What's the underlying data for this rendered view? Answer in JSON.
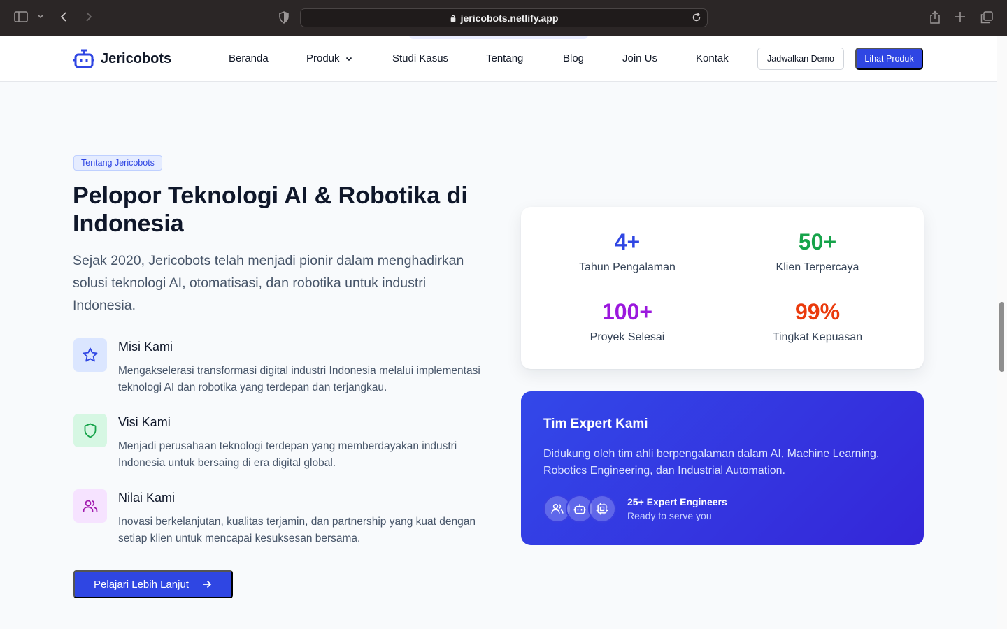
{
  "browser": {
    "url": "jericobots.netlify.app"
  },
  "nav": {
    "brand": "Jericobots",
    "items": [
      "Beranda",
      "Produk",
      "Studi Kasus",
      "Tentang",
      "Blog",
      "Join Us",
      "Kontak"
    ],
    "demo_button": "Jadwalkan Demo",
    "products_button": "Lihat Produk"
  },
  "about": {
    "tag": "Tentang Jericobots",
    "title": "Pelopor Teknologi AI & Robotika di Indonesia",
    "lead": "Sejak 2020, Jericobots telah menjadi pionir dalam menghadirkan solusi teknologi AI, otomatisasi, dan robotika untuk industri Indonesia.",
    "features": [
      {
        "title": "Misi Kami",
        "desc": "Mengakselerasi transformasi digital industri Indonesia melalui implementasi teknologi AI dan robotika yang terdepan dan terjangkau.",
        "icon": "star-icon"
      },
      {
        "title": "Visi Kami",
        "desc": "Menjadi perusahaan teknologi terdepan yang memberdayakan industri Indonesia untuk bersaing di era digital global.",
        "icon": "shield-icon"
      },
      {
        "title": "Nilai Kami",
        "desc": "Inovasi berkelanjutan, kualitas terjamin, dan partnership yang kuat dengan setiap klien untuk mencapai kesuksesan bersama.",
        "icon": "users-icon"
      }
    ],
    "cta": "Pelajari Lebih Lanjut"
  },
  "stats": [
    {
      "value": "4+",
      "label": "Tahun Pengalaman",
      "color": "#2f46e3"
    },
    {
      "value": "50+",
      "label": "Klien Terpercaya",
      "color": "#16a34a"
    },
    {
      "value": "100+",
      "label": "Proyek Selesai",
      "color": "#9b18dd"
    },
    {
      "value": "99%",
      "label": "Tingkat Kepuasan",
      "color": "#ea3a0c"
    }
  ],
  "team": {
    "title": "Tim Expert Kami",
    "desc": "Didukung oleh tim ahli berpengalaman dalam AI, Machine Learning, Robotics Engineering, dan Industrial Automation.",
    "count": "25+ Expert Engineers",
    "sub": "Ready to serve you"
  },
  "colors": {
    "primary": "#2f46e3",
    "misi_bg": "#dbe6ff",
    "visi_bg": "#d6f7e3",
    "nilai_bg": "#f6e3ff"
  }
}
